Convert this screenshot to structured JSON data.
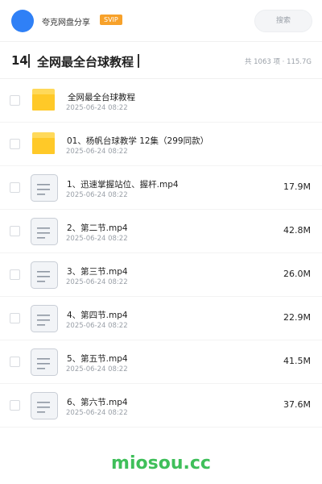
{
  "header": {
    "user_name": "夸克网盘分享",
    "badge": "SVIP",
    "search_placeholder": "搜索"
  },
  "title_bar": {
    "count": "14",
    "title": "全网最全台球教程",
    "meta": "共 1063 项 · 115.7G"
  },
  "files": [
    {
      "type": "folder",
      "name": "全网最全台球教程",
      "date": "2025-06-24 08:22",
      "size": ""
    },
    {
      "type": "folder",
      "name": "01、杨帆台球教学 12集（299同款）",
      "date": "2025-06-24 08:22",
      "size": ""
    },
    {
      "type": "file",
      "name": "1、迅速掌握站位、握杆.mp4",
      "date": "2025-06-24 08:22",
      "size": "17.9M"
    },
    {
      "type": "file",
      "name": "2、第二节.mp4",
      "date": "2025-06-24 08:22",
      "size": "42.8M"
    },
    {
      "type": "file",
      "name": "3、第三节.mp4",
      "date": "2025-06-24 08:22",
      "size": "26.0M"
    },
    {
      "type": "file",
      "name": "4、第四节.mp4",
      "date": "2025-06-24 08:22",
      "size": "22.9M"
    },
    {
      "type": "file",
      "name": "5、第五节.mp4",
      "date": "2025-06-24 08:22",
      "size": "41.5M"
    },
    {
      "type": "file",
      "name": "6、第六节.mp4",
      "date": "2025-06-24 08:22",
      "size": "37.6M"
    }
  ],
  "watermark": "miosou.cc",
  "colors": {
    "avatar": "#2f80f6",
    "svip": "#f7a12a",
    "folder": "#ffc928",
    "watermark": "#3fbf5a"
  }
}
